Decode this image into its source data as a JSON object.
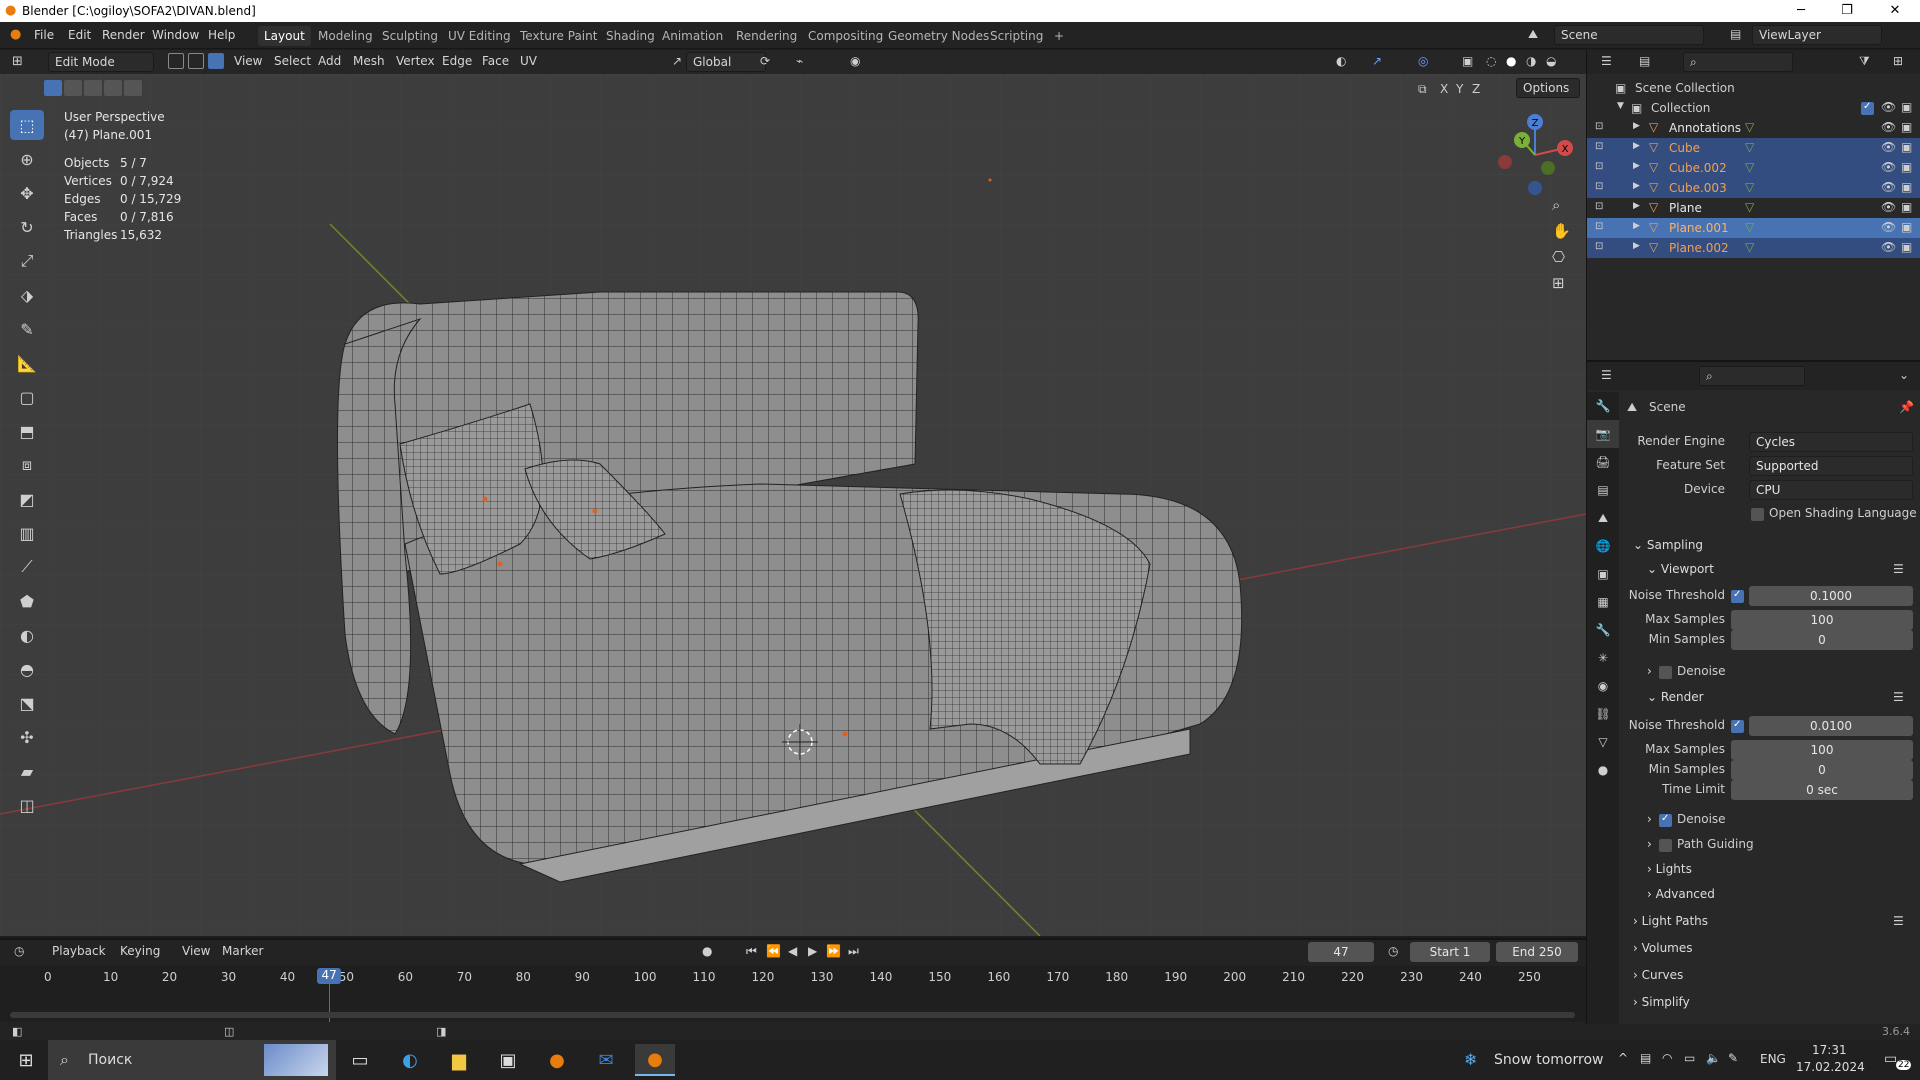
{
  "titlebar": {
    "title": "Blender [C:\\ogiloy\\SOFA2\\DIVAN.blend]",
    "minimize": "─",
    "maximize": "❐",
    "close": "✕"
  },
  "menu": {
    "items": [
      "File",
      "Edit",
      "Render",
      "Window",
      "Help"
    ]
  },
  "workspaces": [
    "Layout",
    "Modeling",
    "Sculpting",
    "UV Editing",
    "Texture Paint",
    "Shading",
    "Animation",
    "Rendering",
    "Compositing",
    "Geometry Nodes",
    "Scripting"
  ],
  "workspace_add": "+",
  "scene": {
    "label": "Scene",
    "viewlayer": "ViewLayer"
  },
  "viewport_header": {
    "mode": "Edit Mode",
    "menus": [
      "View",
      "Select",
      "Add",
      "Mesh",
      "Vertex",
      "Edge",
      "Face",
      "UV"
    ],
    "orientation": "Global",
    "options": "Options",
    "axes": [
      "X",
      "Y",
      "Z"
    ]
  },
  "overlay_text": {
    "view": "User Perspective",
    "object": "(47) Plane.001"
  },
  "stats": [
    {
      "label": "Objects",
      "value": "5 / 7"
    },
    {
      "label": "Vertices",
      "value": "0 / 7,924"
    },
    {
      "label": "Edges",
      "value": "0 / 15,729"
    },
    {
      "label": "Faces",
      "value": "0 / 7,816"
    },
    {
      "label": "Triangles",
      "value": "15,632"
    }
  ],
  "gizmo": {
    "x": "X",
    "y": "Y",
    "z": "Z"
  },
  "outliner": {
    "root": "Scene Collection",
    "collection": "Collection",
    "items": [
      {
        "name": "Annotations",
        "selected": false,
        "color": "#e6e6e6"
      },
      {
        "name": "Cube",
        "selected": true,
        "color": "#f0a050"
      },
      {
        "name": "Cube.002",
        "selected": true,
        "color": "#f0a050"
      },
      {
        "name": "Cube.003",
        "selected": true,
        "color": "#f0a050"
      },
      {
        "name": "Plane",
        "selected": false,
        "color": "#e6e6e6"
      },
      {
        "name": "Plane.001",
        "selected": true,
        "active": true,
        "color": "#ffb060"
      },
      {
        "name": "Plane.002",
        "selected": true,
        "color": "#f0a050"
      }
    ]
  },
  "props": {
    "header": "Scene",
    "render_engine": {
      "label": "Render Engine",
      "value": "Cycles"
    },
    "feature_set": {
      "label": "Feature Set",
      "value": "Supported"
    },
    "device": {
      "label": "Device",
      "value": "CPU"
    },
    "osl": "Open Shading Language",
    "sampling": "Sampling",
    "viewport": {
      "title": "Viewport",
      "noise_label": "Noise Threshold",
      "noise": "0.1000",
      "max_label": "Max Samples",
      "max": "100",
      "min_label": "Min Samples",
      "min": "0",
      "denoise": "Denoise"
    },
    "render": {
      "title": "Render",
      "noise_label": "Noise Threshold",
      "noise": "0.0100",
      "max_label": "Max Samples",
      "max": "100",
      "min_label": "Min Samples",
      "min": "0",
      "time_label": "Time Limit",
      "time": "0 sec",
      "denoise": "Denoise",
      "path_guiding": "Path Guiding",
      "lights": "Lights",
      "advanced": "Advanced"
    },
    "sections": [
      "Light Paths",
      "Volumes",
      "Curves",
      "Simplify"
    ]
  },
  "timeline": {
    "menus": [
      "Playback",
      "Keying",
      "View",
      "Marker"
    ],
    "current": "47",
    "start_label": "Start",
    "start": "1",
    "end_label": "End",
    "end": "250",
    "ticks": [
      "0",
      "10",
      "20",
      "30",
      "40",
      "50",
      "60",
      "70",
      "80",
      "90",
      "100",
      "110",
      "120",
      "130",
      "140",
      "150",
      "160",
      "170",
      "180",
      "190",
      "200",
      "210",
      "220",
      "230",
      "240",
      "250"
    ],
    "playhead": "47",
    "playhead_frame": 47
  },
  "status": {
    "version": "3.6.4"
  },
  "taskbar": {
    "search": "Поиск",
    "weather": "Snow tomorrow",
    "lang": "ENG",
    "time": "17:31",
    "date": "17.02.2024",
    "notif": "22"
  }
}
